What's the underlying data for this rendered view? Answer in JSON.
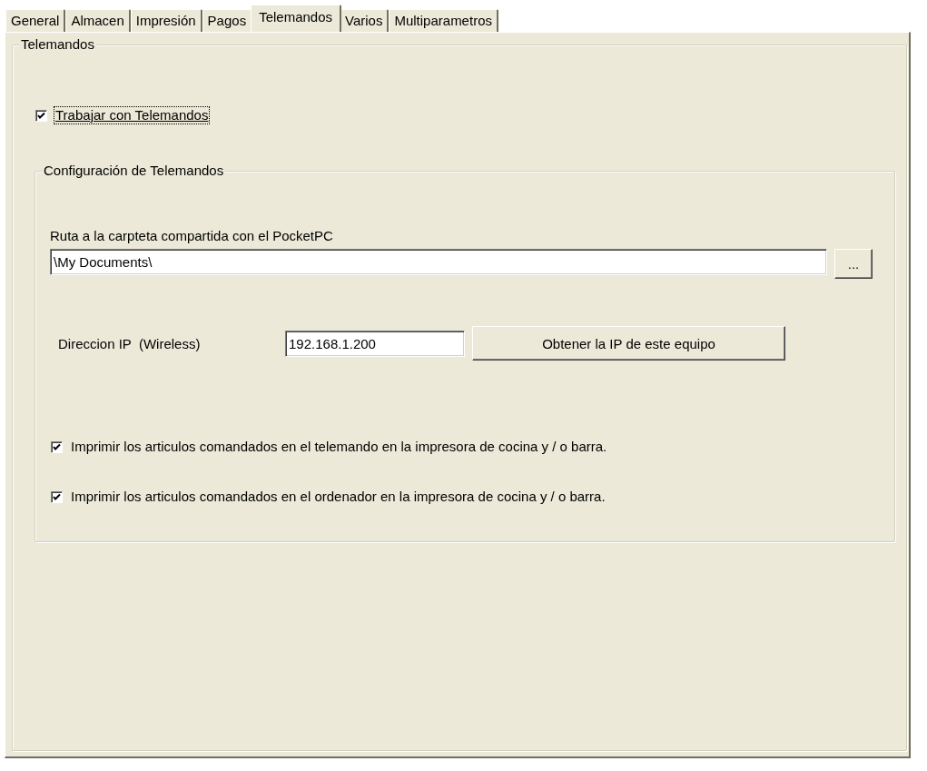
{
  "tabs": [
    {
      "label": "General",
      "selected": false
    },
    {
      "label": "Almacen",
      "selected": false
    },
    {
      "label": "Impresión",
      "selected": false
    },
    {
      "label": "Pagos",
      "selected": false
    },
    {
      "label": "Telemandos",
      "selected": true
    },
    {
      "label": "Varios",
      "selected": false
    },
    {
      "label": "Multiparametros",
      "selected": false
    }
  ],
  "group": {
    "title": "Telemandos",
    "enable": {
      "label": "Trabajar con Telemandos",
      "checked": true,
      "focused": true
    },
    "config": {
      "title": "Configuración de Telemandos",
      "path": {
        "label": "Ruta a la carpteta compartida con el PocketPC",
        "value": "\\My Documents\\",
        "browse": "..."
      },
      "ip": {
        "label": "Direccion IP  (Wireless)",
        "value": "192.168.1.200",
        "button": "Obtener la IP de este equipo"
      },
      "options": [
        {
          "label": "Imprimir los articulos comandados en el telemando en la impresora de cocina y / o barra.",
          "checked": true
        },
        {
          "label": "Imprimir los articulos comandados en el ordenador en la impresora de cocina y / o barra.",
          "checked": true
        }
      ]
    }
  }
}
